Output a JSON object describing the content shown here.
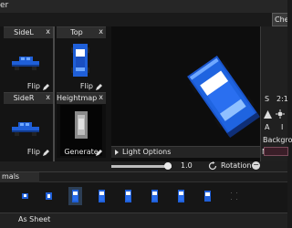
{
  "window": {
    "title_fragment": "er"
  },
  "tabs": {
    "che": "Che"
  },
  "panels": [
    {
      "label": "SideL",
      "button": "Flip"
    },
    {
      "label": "Top",
      "button": "Flip"
    },
    {
      "label": "SideR",
      "button": "Flip"
    },
    {
      "label": "Heightmap",
      "button": "Generate"
    }
  ],
  "close_label": "x",
  "canvas": {
    "light_options": "Light Options"
  },
  "right_panel": {
    "s_label": "S",
    "ratio": "2:1",
    "a_label": "A",
    "i_label": "I",
    "background": "Backgrou",
    "n_label": "N"
  },
  "controls": {
    "light_value": "1.0",
    "rotation_label": "Rotation",
    "rotation_button": "−"
  },
  "bottom": {
    "tab_label": "mals",
    "as_sheet": "As Sheet",
    "thumbnail_count": 10,
    "selected_index": 2
  },
  "colors": {
    "car_blue": "#1f5fd8",
    "car_dark": "#123a8a",
    "car_light": "#6fa8ff",
    "accent": "#7a4a5a"
  }
}
